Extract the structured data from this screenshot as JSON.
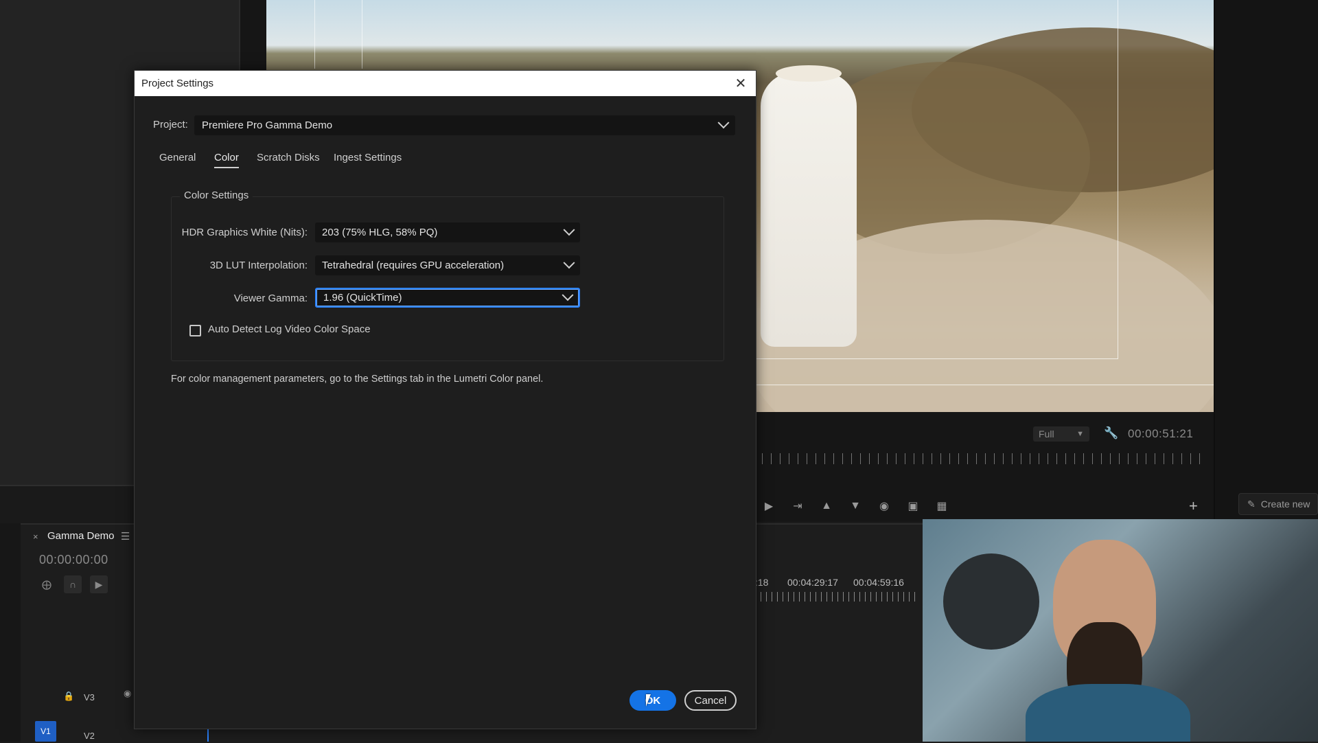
{
  "dialog": {
    "title": "Project Settings",
    "close_icon": "close-icon",
    "project_label": "Project:",
    "project_value": "Premiere Pro Gamma Demo",
    "tabs": [
      {
        "label": "General",
        "active": false
      },
      {
        "label": "Color",
        "active": true
      },
      {
        "label": "Scratch Disks",
        "active": false
      },
      {
        "label": "Ingest Settings",
        "active": false
      }
    ],
    "group_title": "Color Settings",
    "fields": [
      {
        "label": "HDR Graphics White (Nits):",
        "value": "203 (75% HLG, 58% PQ)"
      },
      {
        "label": "3D LUT Interpolation:",
        "value": "Tetrahedral (requires GPU acceleration)"
      },
      {
        "label": "Viewer Gamma:",
        "value": "1.96 (QuickTime)"
      }
    ],
    "checkbox_label": "Auto Detect Log Video Color Space",
    "checkbox_checked": false,
    "info_text": "For color management parameters, go to the Settings tab in the Lumetri Color panel.",
    "ok_label": "OK",
    "cancel_label": "Cancel"
  },
  "program_monitor": {
    "quality": "Full",
    "timecode": "00:00:51:21",
    "create_new_label": "Create new"
  },
  "timeline": {
    "tab_label": "Gamma Demo",
    "timecode": "00:00:00:00",
    "ruler_labels": [
      ":18",
      "00:04:29:17",
      "00:04:59:16"
    ],
    "tracks": [
      "V3",
      "V2",
      "V1"
    ]
  },
  "colors": {
    "accent": "#1473e6",
    "focus_ring": "#2c83ff",
    "dialog_bg": "#1e1e1e",
    "titlebar_bg": "#ffffff"
  }
}
